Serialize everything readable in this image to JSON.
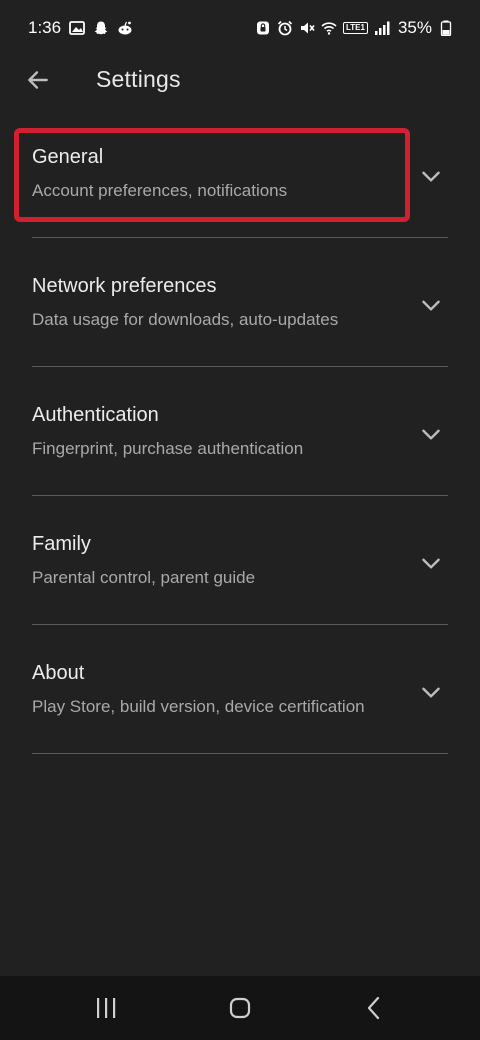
{
  "status_bar": {
    "time": "1:36",
    "network": "LTE1",
    "battery_percent": "35%"
  },
  "app_bar": {
    "title": "Settings",
    "back_icon": "arrow-left-icon"
  },
  "settings": {
    "items": [
      {
        "title": "General",
        "subtitle": "Account preferences, notifications",
        "highlighted": true
      },
      {
        "title": "Network preferences",
        "subtitle": "Data usage for downloads, auto-updates",
        "highlighted": false
      },
      {
        "title": "Authentication",
        "subtitle": "Fingerprint, purchase authentication",
        "highlighted": false
      },
      {
        "title": "Family",
        "subtitle": "Parental control, parent guide",
        "highlighted": false
      },
      {
        "title": "About",
        "subtitle": "Play Store, build version, device certification",
        "highlighted": false
      }
    ],
    "chevron_icon": "chevron-down-icon"
  },
  "nav_bar": {
    "recents_icon": "recents-icon",
    "home_icon": "home-icon",
    "back_icon": "back-icon"
  },
  "colors": {
    "background": "#212121",
    "highlight": "#d1202f",
    "divider": "#5a5a5a",
    "nav_background": "#141414"
  }
}
